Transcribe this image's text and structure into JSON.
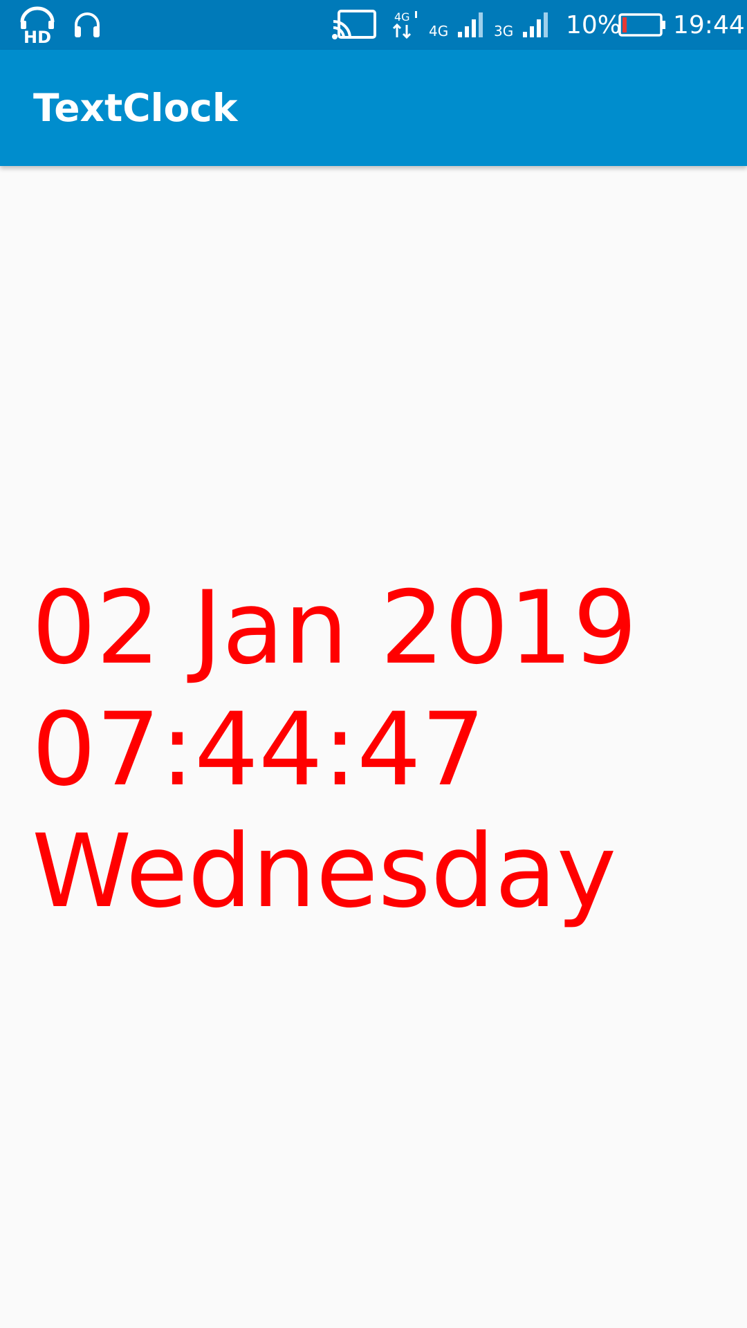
{
  "status_bar": {
    "hd_label": "HD",
    "network_4g_small": "4G",
    "network_4g": "4G",
    "network_3g": "3G",
    "battery_percent": "10%",
    "time": "19:44",
    "icons": [
      "hd-headset-icon",
      "headphones-icon",
      "cast-icon",
      "data-transfer-icon",
      "signal-4g-icon",
      "signal-3g-icon",
      "battery-icon"
    ],
    "colors": {
      "background": "#007ab9",
      "battery_low": "#e53935"
    }
  },
  "app_bar": {
    "title": "TextClock",
    "color": "#008dcd"
  },
  "clock": {
    "date": "02 Jan 2019",
    "time": "07:44:47",
    "weekday": "Wednesday",
    "color": "#ff0000"
  }
}
